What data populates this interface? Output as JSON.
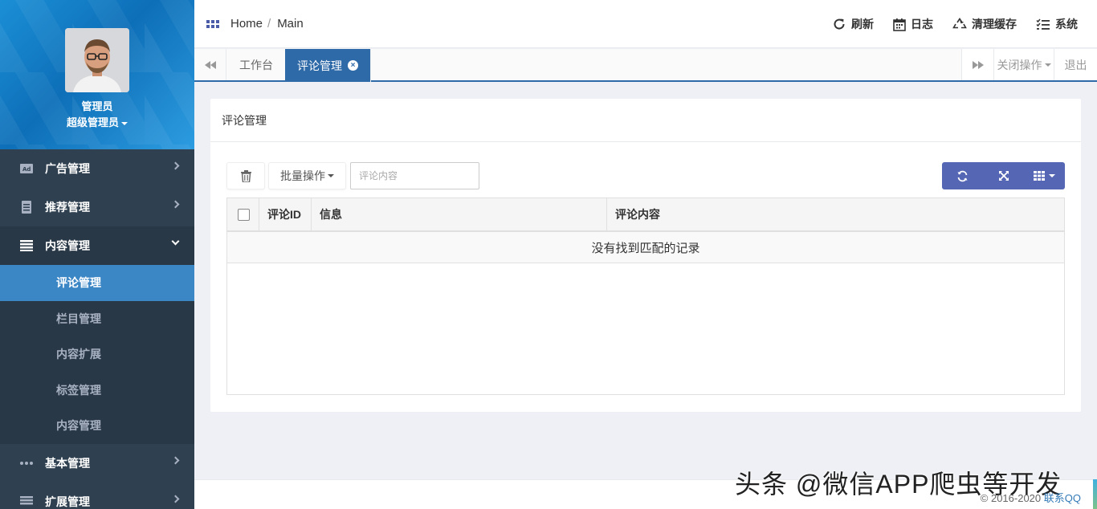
{
  "sidebar": {
    "profile": {
      "name": "管理员",
      "role": "超级管理员"
    },
    "menu": [
      {
        "label": "广告管理",
        "icon": "ad-icon"
      },
      {
        "label": "推荐管理",
        "icon": "document-icon"
      },
      {
        "label": "内容管理",
        "icon": "list-icon",
        "open": true
      },
      {
        "label": "基本管理",
        "icon": "ellipsis-icon"
      },
      {
        "label": "扩展管理",
        "icon": "list-icon"
      }
    ],
    "submenu": [
      {
        "label": "评论管理",
        "active": true
      },
      {
        "label": "栏目管理"
      },
      {
        "label": "内容扩展"
      },
      {
        "label": "标签管理"
      },
      {
        "label": "内容管理"
      }
    ]
  },
  "topbar": {
    "breadcrumb": [
      "Home",
      "Main"
    ],
    "actions": {
      "refresh": "刷新",
      "log": "日志",
      "clear_cache": "清理缓存",
      "system": "系统"
    }
  },
  "tabs": {
    "items": [
      {
        "label": "工作台"
      },
      {
        "label": "评论管理",
        "active": true
      }
    ],
    "close_ops": "关闭操作",
    "logout": "退出"
  },
  "panel": {
    "title": "评论管理",
    "batch_label": "批量操作",
    "search_placeholder": "评论内容",
    "table": {
      "columns": [
        "评论ID",
        "信息",
        "评论内容"
      ],
      "empty_text": "没有找到匹配的记录"
    }
  },
  "footer": {
    "copyright": "© 2016-2020",
    "contact": "联系QQ",
    "watermark": "头条 @微信APP爬虫等开发"
  },
  "colors": {
    "sidebar": "#2f4050",
    "accent": "#2f6aa8",
    "toolbar_group": "#5566b4",
    "active_sub": "#3b86c5"
  }
}
